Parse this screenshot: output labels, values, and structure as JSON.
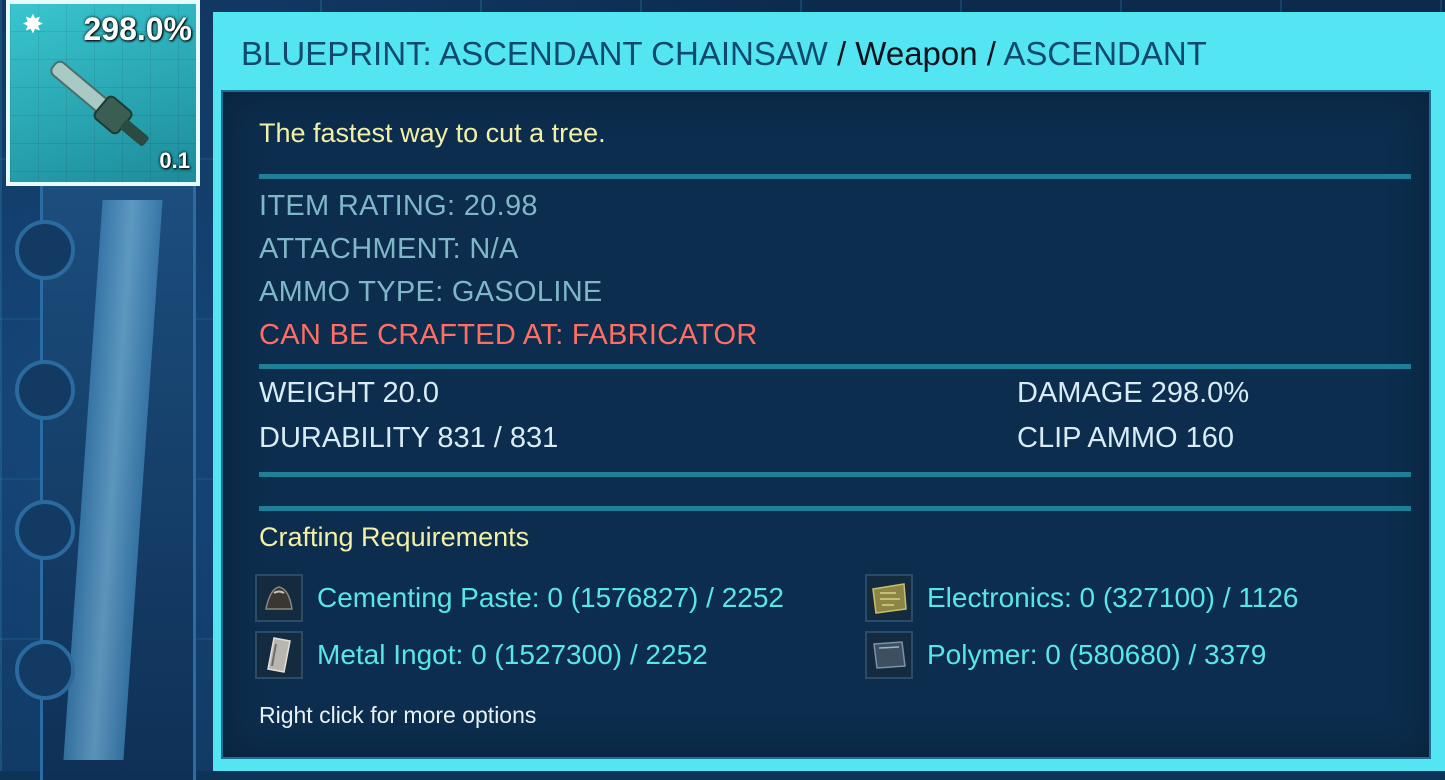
{
  "item_slot": {
    "damage_label": "298.0%",
    "quantity": "0.1",
    "star_icon": "burst-star-icon",
    "item_icon": "chainsaw-icon"
  },
  "tooltip": {
    "title_name": "BLUEPRINT: ASCENDANT CHAINSAW",
    "title_sep1": "/",
    "title_category": "Weapon",
    "title_sep2": "/",
    "title_quality": "ASCENDANT",
    "description": "The fastest way to cut a tree.",
    "item_rating": "ITEM RATING: 20.98",
    "attachment": "ATTACHMENT: N/A",
    "ammo_type": "AMMO TYPE: GASOLINE",
    "crafted_at": "CAN BE CRAFTED AT: FABRICATOR",
    "weight": "WEIGHT 20.0",
    "durability": "DURABILITY 831 / 831",
    "damage": "DAMAGE 298.0%",
    "clip_ammo": "CLIP AMMO 160",
    "crafting_header": "Crafting Requirements",
    "requirements": [
      {
        "label": "Cementing Paste: 0 (1576827) / 2252",
        "icon": "cementing-paste-icon"
      },
      {
        "label": "Electronics: 0 (327100) / 1126",
        "icon": "electronics-icon"
      },
      {
        "label": "Metal Ingot: 0 (1527300) / 2252",
        "icon": "metal-ingot-icon"
      },
      {
        "label": "Polymer: 0 (580680) / 3379",
        "icon": "polymer-icon"
      }
    ],
    "hint": "Right click for more options"
  },
  "colors": {
    "tooltip_frame": "#53e6f2",
    "tooltip_body": "#0c2d4d",
    "description_yellow": "#f2f0a5",
    "stat_grey": "#7fb6c8",
    "warning_red": "#ff6e62",
    "resource_cyan": "#59e6e6"
  }
}
